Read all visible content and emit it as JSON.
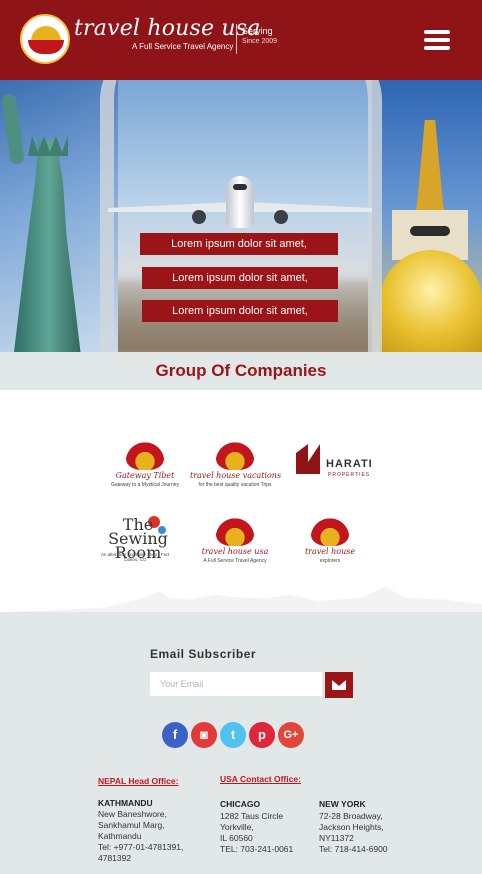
{
  "header": {
    "brand_name": "travel house usa",
    "brand_tagline": "A Full Service Travel Agency",
    "serving_label": "Serving",
    "since_label": "Since 2009",
    "menu_icon": "hamburger-icon"
  },
  "hero": {
    "lines": [
      "Lorem ipsum dolor sit amet,",
      "Lorem ipsum dolor sit amet,",
      "Lorem ipsum dolor sit amet,"
    ]
  },
  "group": {
    "title": "Group Of Companies",
    "companies": [
      {
        "name": "Gateway Tibet",
        "tagline": "Gateway to a Mystical Journey"
      },
      {
        "name": "travel house vacations",
        "tagline": "for the best quality vacation Trips"
      },
      {
        "name": "HARATI",
        "tagline": "PROPERTIES"
      },
      {
        "name": "The Sewing Room",
        "tagline": "An alteration and tailor shop · Fort Collins, CO"
      },
      {
        "name": "travel house usa",
        "tagline": "A Full Service Travel Agency"
      },
      {
        "name": "travel house",
        "tagline": "explorers"
      }
    ]
  },
  "subscribe": {
    "title": "Email Subscriber",
    "placeholder": "Your Email",
    "button_icon": "envelope-icon"
  },
  "social": {
    "facebook": "f",
    "instagram": "◙",
    "twitter": "t",
    "pinterest": "p",
    "googleplus": "G+"
  },
  "offices": {
    "nepal_heading": "NEPAL Head Office:",
    "usa_heading": "USA Contact  Office:",
    "kathmandu": {
      "city": "KATHMANDU",
      "lines": [
        "New Baneshwore,",
        "Sankhamul Marg,",
        "Kathmandu",
        "Tel: +977-01-4781391,",
        "4781392"
      ]
    },
    "chicago": {
      "city": "CHICAGO",
      "lines": [
        "1282 Taus Circle",
        "Yorkville,",
        "IL 60560",
        "TEL: 703-241-0061"
      ]
    },
    "newyork": {
      "city": "NEW YORK",
      "lines": [
        "72-28 Broadway,",
        "Jackson Heights,",
        "NY11372",
        "Tel: 718-414-6900"
      ]
    }
  },
  "colors": {
    "brand_red": "#8f1418",
    "band_gray": "#e2e8e8"
  }
}
